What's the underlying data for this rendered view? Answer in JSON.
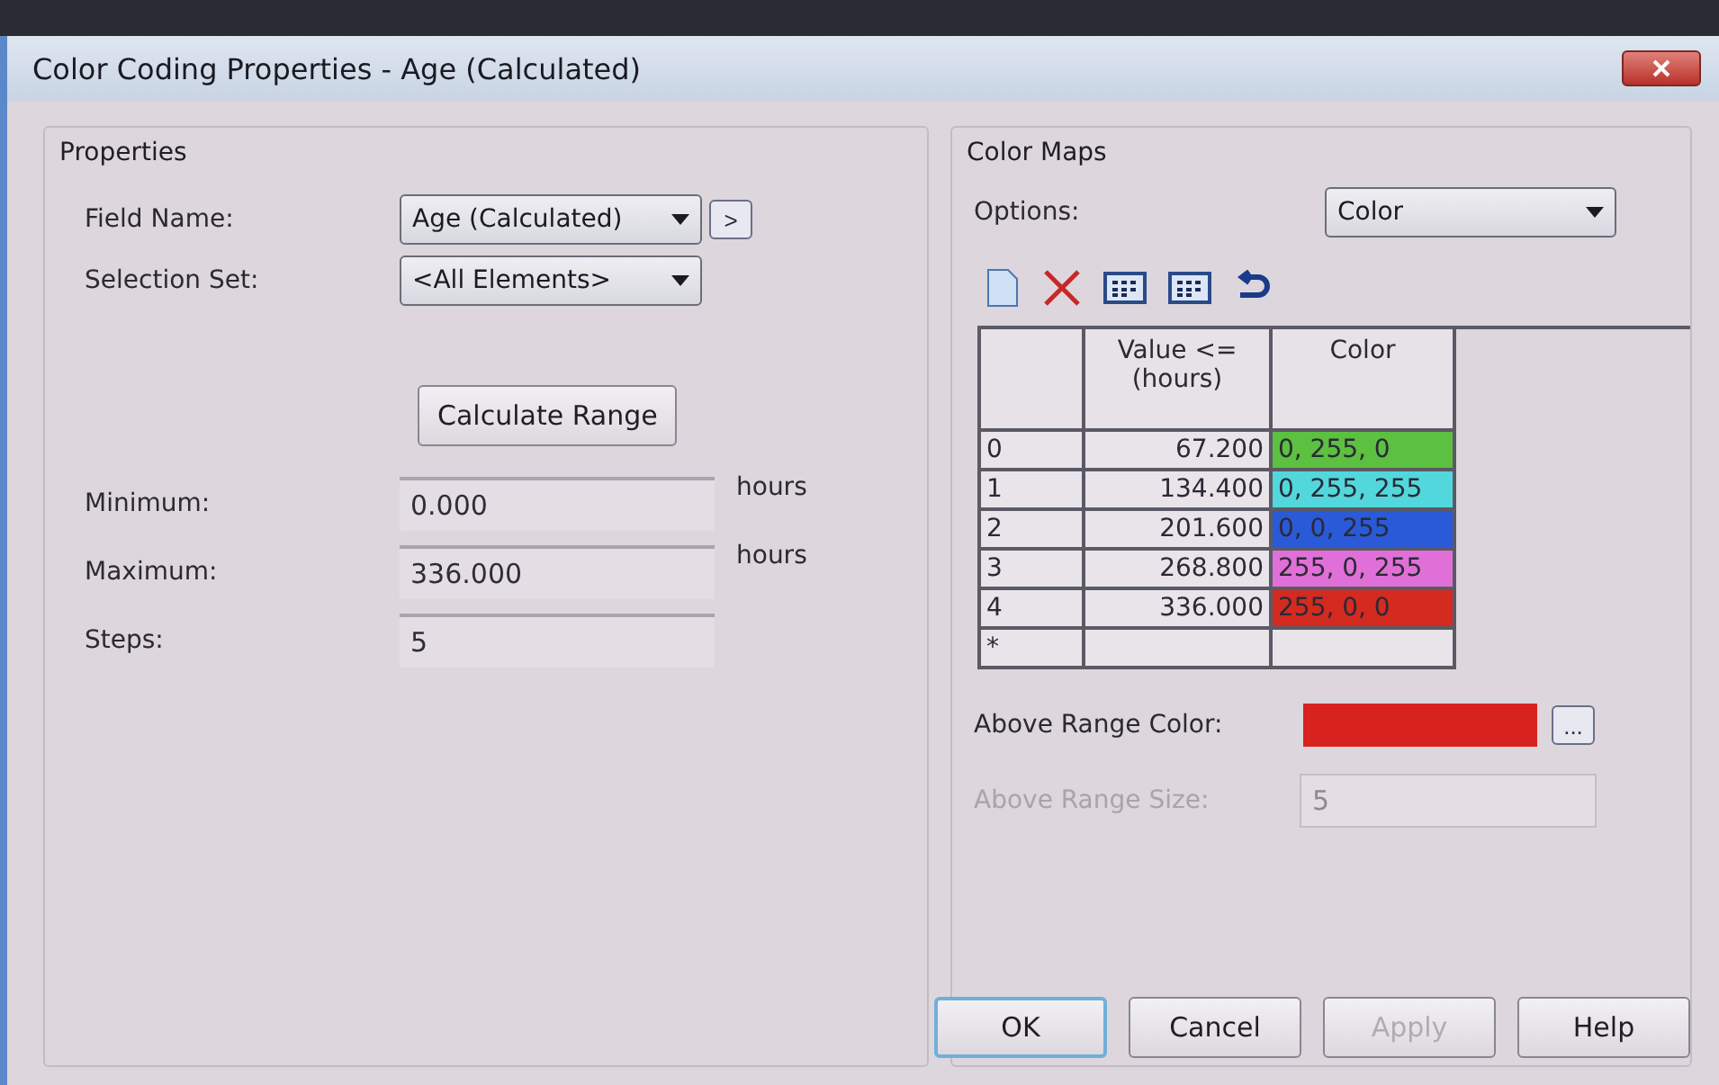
{
  "window": {
    "title": "Color Coding Properties - Age (Calculated)"
  },
  "properties": {
    "title": "Properties",
    "dropdowns": [
      {
        "label": "Field Name:",
        "value": "Age (Calculated)",
        "extra_button": ">"
      },
      {
        "label": "Selection Set:",
        "value": "<All Elements>"
      }
    ],
    "calculate_button": "Calculate Range",
    "fields": [
      {
        "label": "Minimum:",
        "value": "0.000",
        "unit": "hours"
      },
      {
        "label": "Maximum:",
        "value": "336.000",
        "unit": "hours"
      },
      {
        "label": "Steps:",
        "value": "5"
      }
    ]
  },
  "color_maps": {
    "title": "Color Maps",
    "options": {
      "label": "Options:",
      "value": "Color"
    },
    "table": {
      "columns": [
        "Value <= (hours)",
        "Color"
      ],
      "rows": [
        {
          "index": "0",
          "value": "67.200",
          "color_text": "0, 255, 0",
          "color": "#5cc040"
        },
        {
          "index": "1",
          "value": "134.400",
          "color_text": "0, 255, 255",
          "color": "#52d8dc"
        },
        {
          "index": "2",
          "value": "201.600",
          "color_text": "0, 0, 255",
          "color": "#2a5ad8"
        },
        {
          "index": "3",
          "value": "268.800",
          "color_text": "255, 0, 255",
          "color": "#e070d8"
        },
        {
          "index": "4",
          "value": "336.000",
          "color_text": "255, 0, 0",
          "color": "#d42a20"
        }
      ],
      "new_row_marker": "*"
    },
    "above_range_color": {
      "label": "Above Range Color:",
      "color": "#d8221e",
      "button": "..."
    },
    "above_range_size": {
      "label": "Above Range Size:",
      "value": "5",
      "disabled": true
    }
  },
  "buttons": [
    {
      "label": "OK",
      "disabled": false,
      "default": true
    },
    {
      "label": "Cancel",
      "disabled": false,
      "default": false
    },
    {
      "label": "Apply",
      "disabled": true,
      "default": false
    },
    {
      "label": "Help",
      "disabled": false,
      "default": false
    }
  ]
}
